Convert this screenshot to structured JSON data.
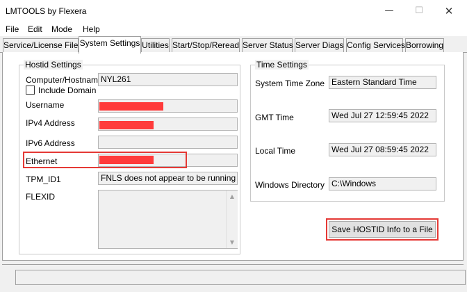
{
  "window": {
    "title": "LMTOOLS by Flexera",
    "minimize_glyph": "—",
    "maximize_glyph": "☐",
    "close_glyph": "✕"
  },
  "menu": {
    "items": [
      {
        "label": "File"
      },
      {
        "label": "Edit"
      },
      {
        "label": "Mode"
      },
      {
        "label": "Help"
      }
    ]
  },
  "tabs": [
    {
      "label": "Service/License File",
      "active": false
    },
    {
      "label": "System Settings",
      "active": true
    },
    {
      "label": "Utilities",
      "active": false
    },
    {
      "label": "Start/Stop/Reread",
      "active": false
    },
    {
      "label": "Server Status",
      "active": false
    },
    {
      "label": "Server Diags",
      "active": false
    },
    {
      "label": "Config Services",
      "active": false
    },
    {
      "label": "Borrowing",
      "active": false
    }
  ],
  "hostid_group": {
    "title": "Hostid Settings",
    "computer_hostname_label": "Computer/Hostname",
    "computer_hostname_value": "NYL261",
    "include_domain_label": "Include Domain",
    "include_domain_checked": false,
    "username_label": "Username",
    "ipv4_label": "IPv4 Address",
    "ipv6_label": "IPv6 Address",
    "ethernet_label": "Ethernet",
    "tpm_label": "TPM_ID1",
    "tpm_value": "FNLS does not appear to be running",
    "flexid_label": "FLEXID",
    "scroll_up_glyph": "▲",
    "scroll_down_glyph": "▼"
  },
  "time_group": {
    "title": "Time Settings",
    "system_time_zone_label": "System Time Zone",
    "system_time_zone_value": "Eastern Standard Time",
    "gmt_time_label": "GMT Time",
    "gmt_time_value": "Wed Jul 27 12:59:45 2022",
    "local_time_label": "Local Time",
    "local_time_value": "Wed Jul 27 08:59:45 2022",
    "windows_directory_label": "Windows Directory",
    "windows_directory_value": "C:\\Windows"
  },
  "buttons": {
    "save_hostid": "Save HOSTID Info to a File"
  },
  "colors": {
    "redaction": "#ff3b3b",
    "highlight": "#e53935"
  }
}
